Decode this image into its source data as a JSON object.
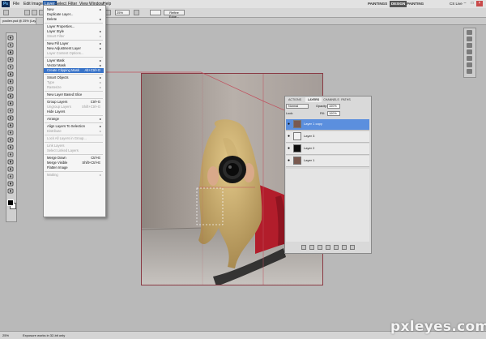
{
  "app": {
    "logo": "Ps"
  },
  "menubar": {
    "items": [
      "File",
      "Edit",
      "Image",
      "Layer",
      "Select",
      "Filter",
      "View",
      "Window",
      "Help"
    ],
    "active": "Layer"
  },
  "workspaces": [
    "PAINTINGS",
    "DESIGN",
    "PAINTING"
  ],
  "active_workspace": "DESIGN",
  "cs_live": "CS Live",
  "options_bar": {
    "zoom": "25%",
    "refine_edge": "Refine Edge..."
  },
  "document_tab": "posilen.psd @ 25% (Layer 1 c...",
  "layer_menu": {
    "items": [
      {
        "label": "New",
        "arrow": "▸"
      },
      {
        "label": "Duplicate Layer..."
      },
      {
        "label": "Delete",
        "arrow": "▸"
      },
      {
        "sep": true
      },
      {
        "label": "Layer Properties..."
      },
      {
        "label": "Layer Style",
        "arrow": "▸"
      },
      {
        "label": "Smart Filter",
        "disabled": true,
        "arrow": "▸"
      },
      {
        "sep": true
      },
      {
        "label": "New Fill Layer",
        "arrow": "▸"
      },
      {
        "label": "New Adjustment Layer",
        "arrow": "▸"
      },
      {
        "label": "Layer Content Options...",
        "disabled": true
      },
      {
        "sep": true
      },
      {
        "label": "Layer Mask",
        "arrow": "▸"
      },
      {
        "label": "Vector Mask",
        "arrow": "▸"
      },
      {
        "label": "Create Clipping Mask",
        "shortcut": "Alt+Ctrl+G",
        "highlighted": true
      },
      {
        "sep": true
      },
      {
        "label": "Smart Objects",
        "arrow": "▸"
      },
      {
        "label": "Type",
        "disabled": true,
        "arrow": "▸"
      },
      {
        "label": "Rasterize",
        "disabled": true,
        "arrow": "▸"
      },
      {
        "sep": true
      },
      {
        "label": "New Layer Based Slice"
      },
      {
        "sep": true
      },
      {
        "label": "Group Layers",
        "shortcut": "Ctrl+G"
      },
      {
        "label": "Ungroup Layers",
        "shortcut": "Shift+Ctrl+G",
        "disabled": true
      },
      {
        "label": "Hide Layers"
      },
      {
        "sep": true
      },
      {
        "label": "Arrange",
        "arrow": "▸"
      },
      {
        "sep": true
      },
      {
        "label": "Align Layers To Selection",
        "arrow": "▸"
      },
      {
        "label": "Distribute",
        "disabled": true,
        "arrow": "▸"
      },
      {
        "sep": true
      },
      {
        "label": "Lock All Layers in Group...",
        "disabled": true
      },
      {
        "sep": true
      },
      {
        "label": "Link Layers",
        "disabled": true
      },
      {
        "label": "Select Linked Layers",
        "disabled": true
      },
      {
        "sep": true
      },
      {
        "label": "Merge Down",
        "shortcut": "Ctrl+E"
      },
      {
        "label": "Merge Visible",
        "shortcut": "Shift+Ctrl+E"
      },
      {
        "label": "Flatten Image"
      },
      {
        "sep": true
      },
      {
        "label": "Matting",
        "disabled": true,
        "arrow": "▸"
      }
    ]
  },
  "layers_panel": {
    "tabs": [
      "ACTIONS",
      "LAYERS",
      "CHANNELS",
      "PATHS"
    ],
    "active_tab": "LAYERS",
    "blend_mode": "Normal",
    "opacity_label": "Opacity:",
    "opacity": "100%",
    "lock_label": "Lock:",
    "fill_label": "Fill:",
    "fill": "100%",
    "layers": [
      {
        "name": "Layer 1 copy",
        "selected": true,
        "thumb": "#7a5a50"
      },
      {
        "name": "Layer 3",
        "selected": false,
        "thumb": "#f2f2f2"
      },
      {
        "name": "Layer 2",
        "selected": false,
        "thumb": "#0d0d0d"
      },
      {
        "name": "Layer 1",
        "selected": false,
        "thumb": "#7a5a50"
      }
    ]
  },
  "status_bar": {
    "zoom": "25%",
    "info": "Exposure works in 32-bit only"
  },
  "watermark": "pxleyes.com",
  "colors": {
    "highlight": "#3973c8",
    "selected_layer": "#5b8fde",
    "guide": "#c0505e"
  }
}
